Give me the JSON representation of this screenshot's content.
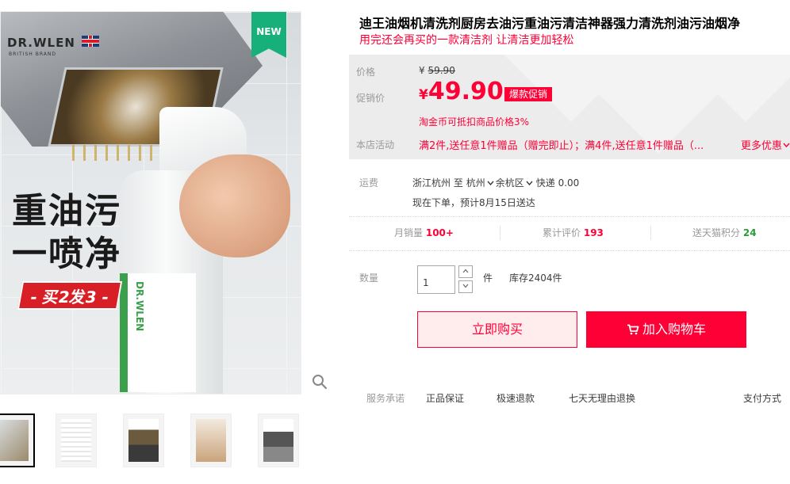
{
  "gallery": {
    "brand": "DR.WLEN",
    "brand_sub": "BRITISH BRAND",
    "new_badge": "NEW",
    "headline_line1": "重油污",
    "headline_line2": "一喷净",
    "promo_tag": "- 买2发3 -",
    "bottle_brand": "DR.WLEN",
    "thumbnails": [
      {
        "name": "thumb-1",
        "active": true
      },
      {
        "name": "thumb-2",
        "active": false
      },
      {
        "name": "thumb-3",
        "active": false
      },
      {
        "name": "thumb-4",
        "active": false
      },
      {
        "name": "thumb-5",
        "active": false
      }
    ],
    "zoom_icon": "magnifier-icon"
  },
  "product": {
    "title": "迪王油烟机清洗剂厨房去油污重油污清洁神器强力清洗剂油污油烟净",
    "subtitle": "用完还会再买的一款清洁剂 让清洁更加轻松"
  },
  "price": {
    "orig_label": "价格",
    "orig_currency": "¥",
    "orig_value": "59.90",
    "promo_label": "促销价",
    "promo_currency": "¥",
    "promo_value": "49.90",
    "promo_tag": "爆款促销",
    "coin_note": "淘金币可抵扣商品价格3%",
    "activity_label": "本店活动",
    "activity_text": "满2件,送任意1件赠品（赠完即止）；满4件,送任意1件赠品（...",
    "more_link": "更多优惠",
    "more_icon": "chevron-down-icon"
  },
  "shipping": {
    "label": "运费",
    "from": "浙江杭州",
    "to_word": "至",
    "city": "杭州",
    "district": "余杭区",
    "method": "快递",
    "fee": "0.00",
    "delivery": "现在下单，预计8月15日送达"
  },
  "stats": {
    "sales_label": "月销量",
    "sales_value": "100+",
    "reviews_label": "累计评价",
    "reviews_value": "193",
    "points_label": "送天猫积分",
    "points_value": "24"
  },
  "quantity": {
    "label": "数量",
    "value": "1",
    "unit": "件",
    "stock": "库存2404件"
  },
  "actions": {
    "buy_now": "立即购买",
    "add_to_cart": "加入购物车"
  },
  "service": {
    "label": "服务承诺",
    "items": [
      "正品保证",
      "极速退款",
      "七天无理由退换"
    ],
    "payment": "支付方式"
  },
  "colors": {
    "accent": "#ff0036",
    "green": "#2a9a37",
    "muted": "#999999"
  }
}
